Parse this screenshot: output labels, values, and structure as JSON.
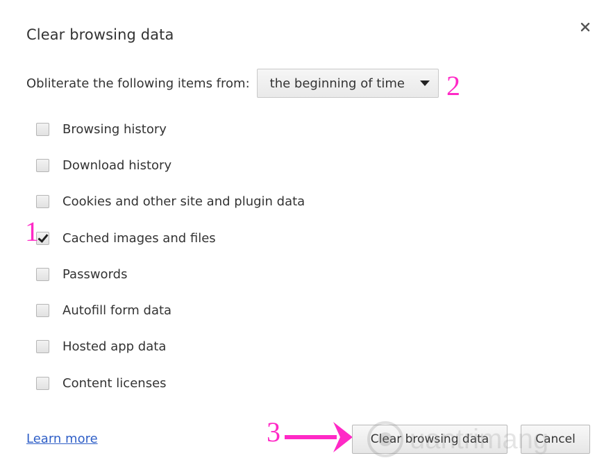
{
  "dialog": {
    "title": "Clear browsing data"
  },
  "from": {
    "label": "Obliterate the following items from:",
    "selected": "the beginning of time"
  },
  "items": [
    {
      "label": "Browsing history",
      "checked": false
    },
    {
      "label": "Download history",
      "checked": false
    },
    {
      "label": "Cookies and other site and plugin data",
      "checked": false
    },
    {
      "label": "Cached images and files",
      "checked": true
    },
    {
      "label": "Passwords",
      "checked": false
    },
    {
      "label": "Autofill form data",
      "checked": false
    },
    {
      "label": "Hosted app data",
      "checked": false
    },
    {
      "label": "Content licenses",
      "checked": false
    }
  ],
  "footer": {
    "learn_more": "Learn more",
    "clear_button": "Clear browsing data",
    "cancel_button": "Cancel"
  },
  "annotations": {
    "step1": "1",
    "step2": "2",
    "step3": "3",
    "color": "#ff29c6"
  },
  "icons": {
    "close": "close-icon",
    "dropdown": "chevron-down-icon",
    "check": "check-icon",
    "arrow": "arrow-right-icon"
  }
}
